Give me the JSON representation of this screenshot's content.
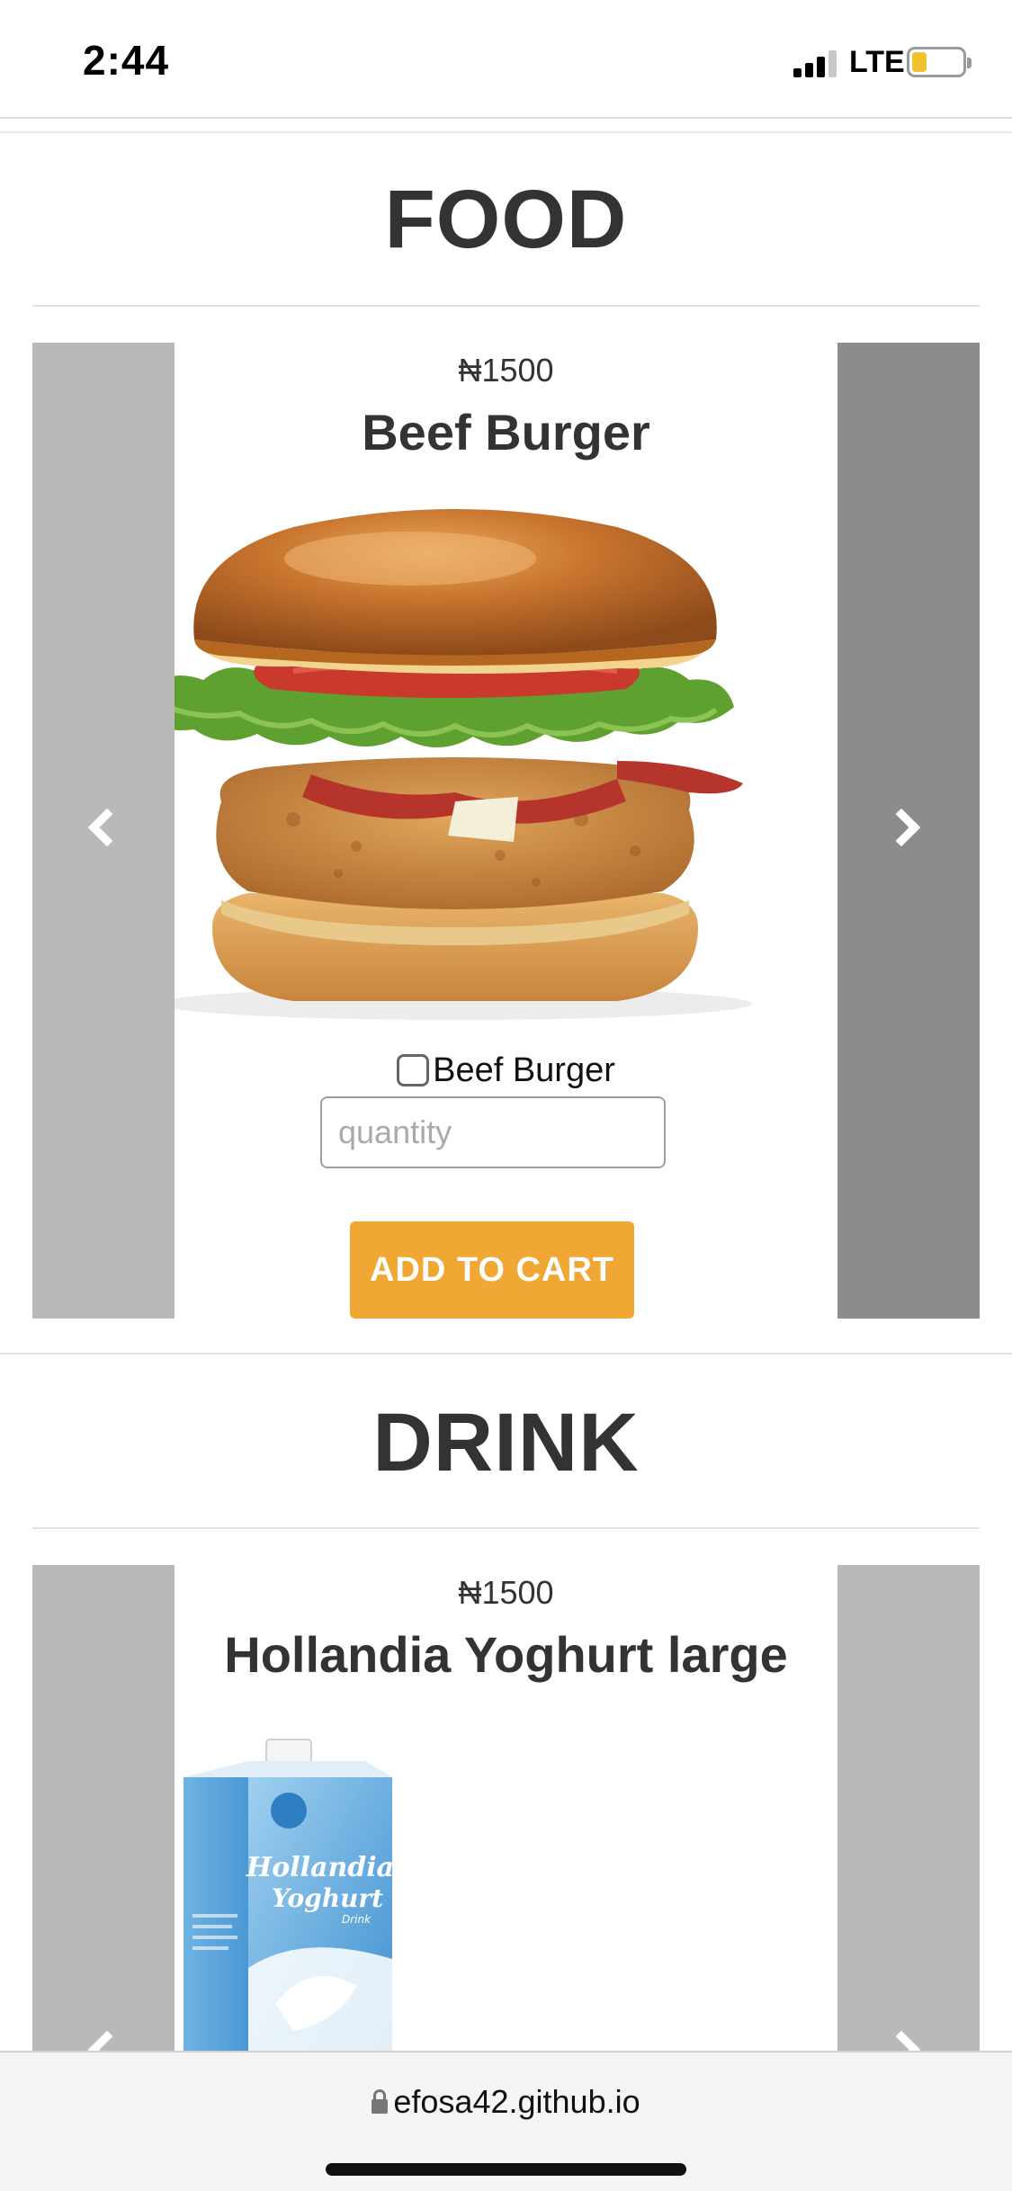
{
  "status_bar": {
    "time": "2:44",
    "network": "LTE",
    "battery_level": 0.3
  },
  "sections": {
    "food": {
      "title": "FOOD",
      "product": {
        "price": "₦1500",
        "name": "Beef Burger",
        "checkbox_label": "Beef Burger",
        "quantity_placeholder": "quantity",
        "button_label": "ADD TO CART"
      }
    },
    "drink": {
      "title": "DRINK",
      "product": {
        "price": "₦1500",
        "name": "Hollandia Yoghurt large",
        "carton_brand": "Hollandia",
        "carton_product": "Yoghurt",
        "carton_sub": "Drink"
      }
    }
  },
  "browser": {
    "url": "efosa42.github.io"
  },
  "colors": {
    "accent": "#f0a733",
    "text": "#333333",
    "nav_light": "#b9b9b9",
    "nav_dark": "#8c8c8c"
  },
  "icons": {
    "prev": "chevron-left-icon",
    "next": "chevron-right-icon",
    "lock": "lock-icon"
  }
}
